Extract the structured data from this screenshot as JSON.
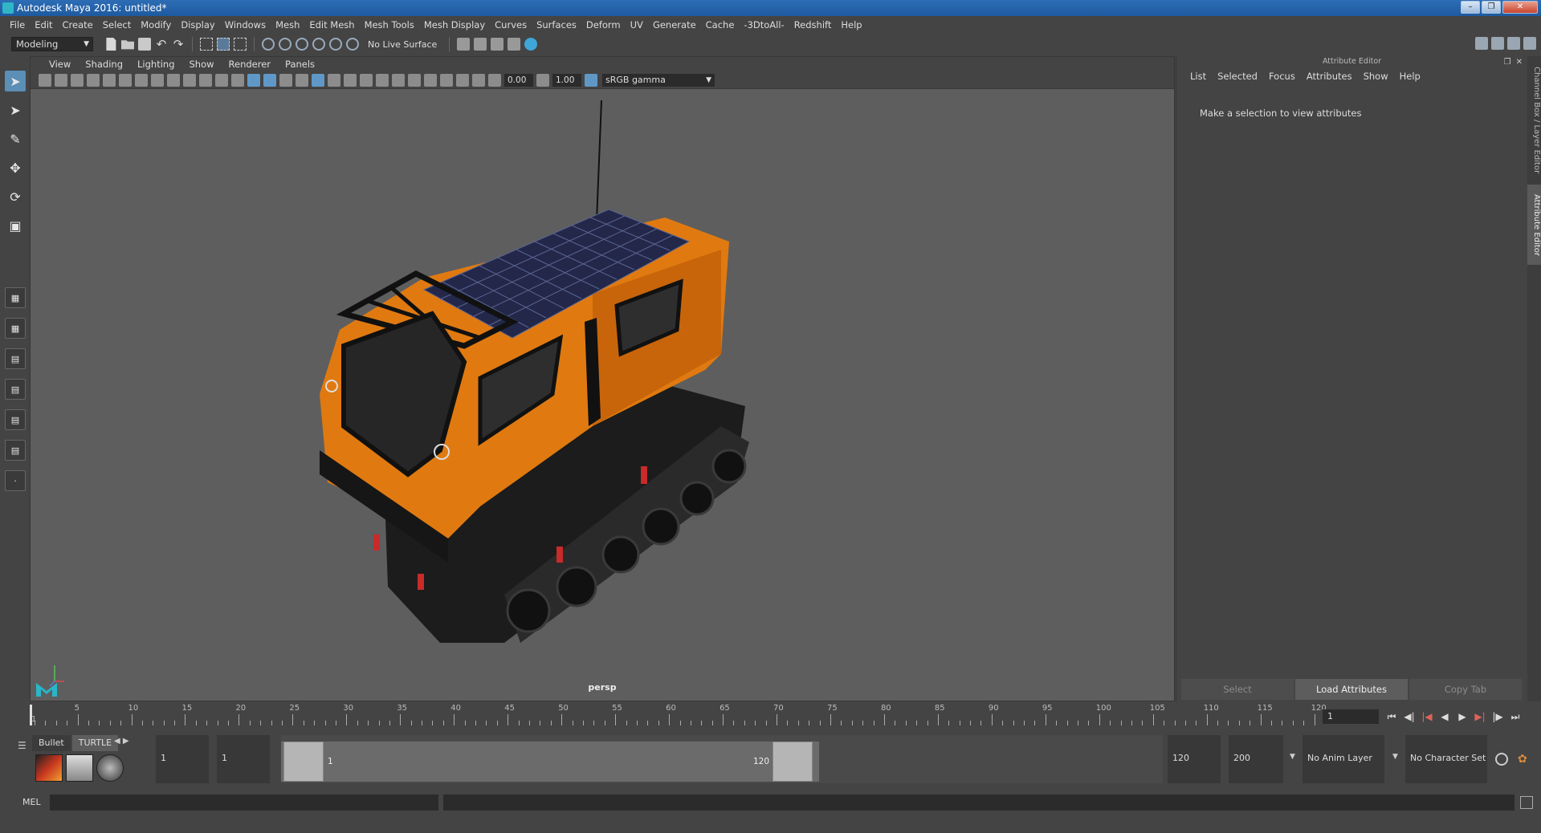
{
  "window": {
    "title": "Autodesk Maya 2016: untitled*"
  },
  "menubar": [
    "File",
    "Edit",
    "Create",
    "Select",
    "Modify",
    "Display",
    "Windows",
    "Mesh",
    "Edit Mesh",
    "Mesh Tools",
    "Mesh Display",
    "Curves",
    "Surfaces",
    "Deform",
    "UV",
    "Generate",
    "Cache",
    "-3DtoAll-",
    "Redshift",
    "Help"
  ],
  "statusline": {
    "mode": "Modeling",
    "live_surface": "No Live Surface"
  },
  "viewport": {
    "menu": [
      "View",
      "Shading",
      "Lighting",
      "Show",
      "Renderer",
      "Panels"
    ],
    "exposure": "0.00",
    "gamma_value": "1.00",
    "color_space": "sRGB gamma",
    "camera_label": "persp"
  },
  "attribute_editor": {
    "title": "Attribute Editor",
    "menu": [
      "List",
      "Selected",
      "Focus",
      "Attributes",
      "Show",
      "Help"
    ],
    "message": "Make a selection to view attributes",
    "buttons": {
      "select": "Select",
      "load": "Load Attributes",
      "copy": "Copy Tab"
    }
  },
  "side_tabs": {
    "channel_box": "Channel Box / Layer Editor",
    "attribute_editor": "Attribute Editor"
  },
  "timeslider": {
    "tick_labels": [
      "5",
      "10",
      "15",
      "20",
      "25",
      "30",
      "35",
      "40",
      "45",
      "50",
      "55",
      "60",
      "65",
      "70",
      "75",
      "80",
      "85",
      "90",
      "95",
      "100",
      "105",
      "110",
      "115",
      "120"
    ],
    "start_label": "1",
    "current_frame": "1"
  },
  "shelf": {
    "tabs": [
      "Bullet",
      "TURTLE"
    ]
  },
  "range": {
    "start": "1",
    "playback_start": "1",
    "range_start_label": "1",
    "range_end_label": "120",
    "playback_end": "120",
    "end": "200",
    "anim_layer": "No Anim Layer",
    "character_set": "No Character Set"
  },
  "cmdline": {
    "language": "MEL"
  },
  "colors": {
    "vehicle_body": "#e07a10",
    "accent_blue": "#5b8fb6",
    "background": "#5e5e5e"
  }
}
